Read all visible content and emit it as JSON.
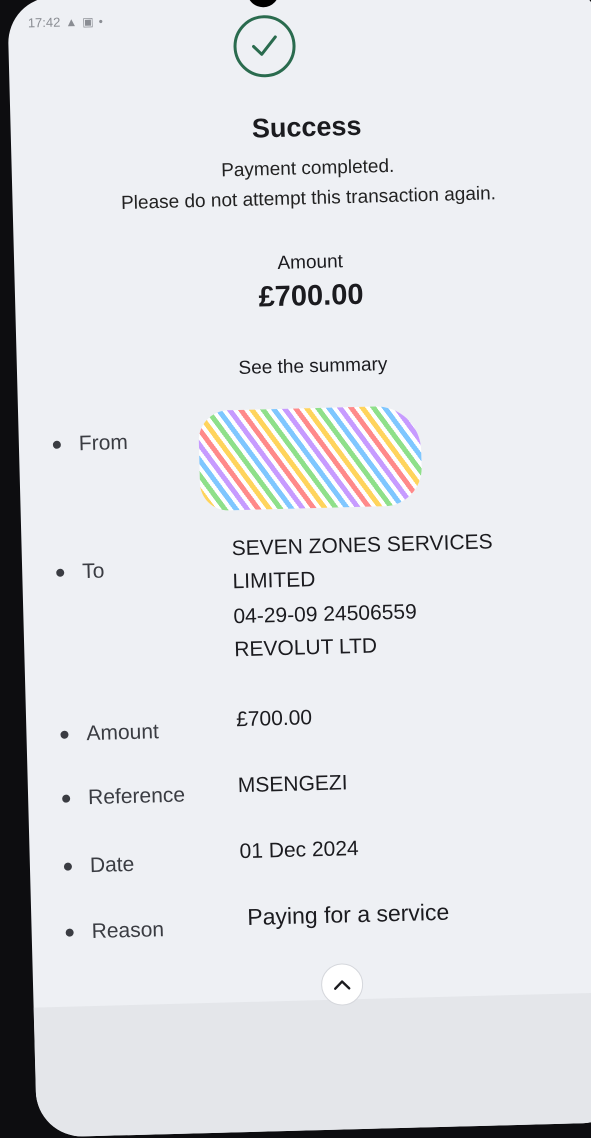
{
  "status_bar": {
    "time": "17:42"
  },
  "confirmation": {
    "title": "Success",
    "line1": "Payment completed.",
    "line2": "Please do not attempt this transaction again.",
    "amount_label": "Amount",
    "amount_value": "£700.00",
    "summary_link": "See the summary"
  },
  "summary": {
    "from_label": "From",
    "to_label": "To",
    "to_name_line1": "SEVEN ZONES SERVICES",
    "to_name_line2": "LIMITED",
    "to_account": "04-29-09 24506559",
    "to_bank": "REVOLUT LTD",
    "amount_label": "Amount",
    "amount_value": "£700.00",
    "reference_label": "Reference",
    "reference_value": "MSENGEZI",
    "date_label": "Date",
    "date_value": "01 Dec 2024",
    "reason_label": "Reason",
    "reason_value": "Paying for a service"
  },
  "icons": {
    "success": "check-circle-icon",
    "collapse": "chevron-up-icon"
  },
  "colors": {
    "success_green": "#2a6b4e",
    "background": "#eef0f4"
  }
}
